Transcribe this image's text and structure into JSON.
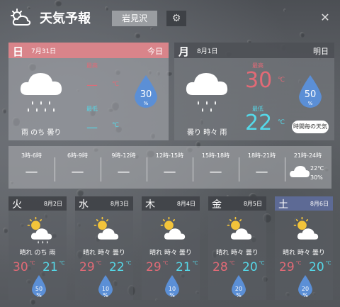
{
  "app": {
    "title": "天気予報",
    "location": "岩見沢",
    "settings_icon": "gear-icon",
    "close_icon": "close-icon",
    "logo_icon": "sun-cloud-logo"
  },
  "today": {
    "day_of_week": "日",
    "date": "7月31日",
    "relative": "今日",
    "description": "雨 のち 曇り",
    "icon": "cloud-rain-icon",
    "high_label": "最高",
    "low_label": "最低",
    "high": "—",
    "low": "—",
    "unit": "℃",
    "precip": "30",
    "precip_unit": "%",
    "header_color": "#d9848a"
  },
  "tomorrow": {
    "day_of_week": "月",
    "date": "8月1日",
    "relative": "明日",
    "description": "曇り 時々 雨",
    "icon": "cloud-rain-icon",
    "high_label": "最高",
    "low_label": "最低",
    "high": "30",
    "low": "22",
    "unit": "℃",
    "precip": "50",
    "precip_unit": "%",
    "hourly_button": "時間毎の天気"
  },
  "hourly": [
    {
      "time": "3時-6時",
      "value": "—"
    },
    {
      "time": "6時-9時",
      "value": "—"
    },
    {
      "time": "9時-12時",
      "value": "—"
    },
    {
      "time": "12時-15時",
      "value": "—"
    },
    {
      "time": "15時-18時",
      "value": "—"
    },
    {
      "time": "18時-21時",
      "value": "—"
    },
    {
      "time": "21時-24時",
      "temp": "22℃",
      "precip": "30%",
      "icon": "cloud-icon"
    }
  ],
  "week": [
    {
      "dow": "火",
      "date": "8月2日",
      "desc": "晴れ のち 雨",
      "high": "30",
      "low": "21",
      "unit": "℃",
      "precip": "50",
      "icon": "sun-cloud-rain-icon"
    },
    {
      "dow": "水",
      "date": "8月3日",
      "desc": "晴れ 時々 曇り",
      "high": "29",
      "low": "22",
      "unit": "℃",
      "precip": "10",
      "icon": "sun-cloud-icon"
    },
    {
      "dow": "木",
      "date": "8月4日",
      "desc": "晴れ 時々 曇り",
      "high": "29",
      "low": "21",
      "unit": "℃",
      "precip": "10",
      "icon": "sun-cloud-icon"
    },
    {
      "dow": "金",
      "date": "8月5日",
      "desc": "晴れ 時々 曇り",
      "high": "28",
      "low": "20",
      "unit": "℃",
      "precip": "20",
      "icon": "sun-cloud-icon"
    },
    {
      "dow": "土",
      "date": "8月6日",
      "desc": "晴れ 時々 曇り",
      "high": "29",
      "low": "20",
      "unit": "℃",
      "precip": "20",
      "icon": "sun-cloud-icon"
    }
  ],
  "colors": {
    "high": "#e26a76",
    "low": "#55d8e8",
    "drop": "#5b8fd6",
    "saturday_header": "#5d6a95"
  }
}
